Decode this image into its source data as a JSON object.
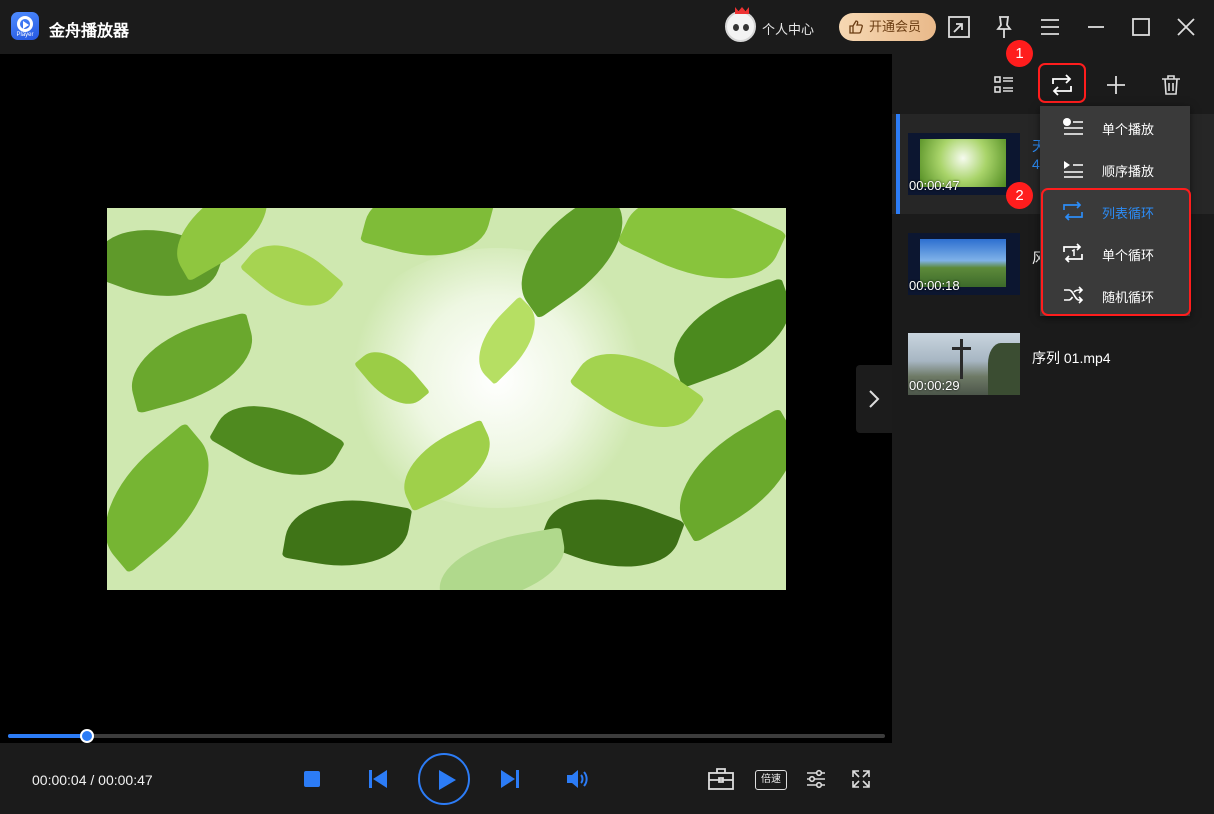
{
  "app": {
    "title": "金舟播放器",
    "logo_text": "Player"
  },
  "header": {
    "user_center": "个人中心",
    "vip_label": "开通会员"
  },
  "player": {
    "time_current": "00:00:04",
    "time_total": "00:00:47",
    "progress": 0.09,
    "speed_label": "倍速"
  },
  "annotations": {
    "step1": "1",
    "step2": "2"
  },
  "playlist": [
    {
      "name": "天",
      "sub": "4",
      "duration": "00:00:47",
      "active": true
    },
    {
      "name": "风",
      "sub": "",
      "duration": "00:00:18",
      "active": false
    },
    {
      "name": "序列 01.mp4",
      "sub": "",
      "duration": "00:00:29",
      "active": false
    }
  ],
  "menu": {
    "items": [
      {
        "label": "单个播放",
        "icon": "single-play-icon",
        "selected": false
      },
      {
        "label": "顺序播放",
        "icon": "sequential-play-icon",
        "selected": false
      },
      {
        "label": "列表循环",
        "icon": "list-loop-icon",
        "selected": true
      },
      {
        "label": "单个循环",
        "icon": "single-loop-icon",
        "selected": false
      },
      {
        "label": "随机循环",
        "icon": "shuffle-loop-icon",
        "selected": false
      }
    ]
  },
  "colors": {
    "accent": "#2c7cf6",
    "highlight": "#ff1d1d",
    "vip": "#e9b98a"
  }
}
